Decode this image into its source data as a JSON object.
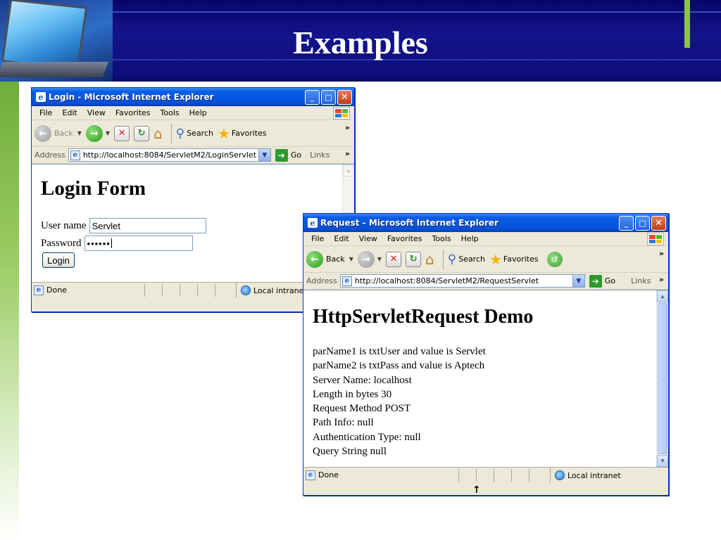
{
  "slide": {
    "title": "Examples",
    "colors": {
      "header": "#0c0c78",
      "accent": "#8cc63f",
      "left_bar": "#6fae3a"
    }
  },
  "login_window": {
    "title": "Login - Microsoft Internet Explorer",
    "menu": [
      "File",
      "Edit",
      "View",
      "Favorites",
      "Tools",
      "Help"
    ],
    "toolbar": {
      "back": "Back",
      "search": "Search",
      "favorites": "Favorites"
    },
    "address": {
      "label": "Address",
      "url": "http://localhost:8084/ServletM2/LoginServlet",
      "go": "Go",
      "links": "Links"
    },
    "page": {
      "heading": "Login Form",
      "username_label": "User name",
      "username_value": "Servlet",
      "password_label": "Password",
      "password_value": "••••••",
      "submit_label": "Login"
    },
    "status": {
      "text": "Done",
      "zone": "Local intranet"
    }
  },
  "request_window": {
    "title": "Request - Microsoft Internet Explorer",
    "menu": [
      "File",
      "Edit",
      "View",
      "Favorites",
      "Tools",
      "Help"
    ],
    "toolbar": {
      "back": "Back",
      "search": "Search",
      "favorites": "Favorites"
    },
    "address": {
      "label": "Address",
      "url": "http://localhost:8084/ServletM2/RequestServlet",
      "go": "Go",
      "links": "Links"
    },
    "page": {
      "heading": "HttpServletRequest Demo",
      "lines": [
        "parName1 is txtUser and value is Servlet",
        "parName2 is txtPass and value is Aptech",
        "Server Name: localhost",
        "Length in bytes 30",
        "Request Method POST",
        "Path Info: null",
        "Authentication Type: null",
        "Query String null"
      ]
    },
    "status": {
      "text": "Done",
      "zone": "Local intranet"
    }
  },
  "icons": {
    "window_controls": [
      "minimize-icon",
      "maximize-icon",
      "close-icon"
    ],
    "toolbar": [
      "back-icon",
      "forward-icon",
      "stop-icon",
      "refresh-icon",
      "home-icon",
      "search-icon",
      "favorites-star-icon",
      "history-icon"
    ]
  }
}
